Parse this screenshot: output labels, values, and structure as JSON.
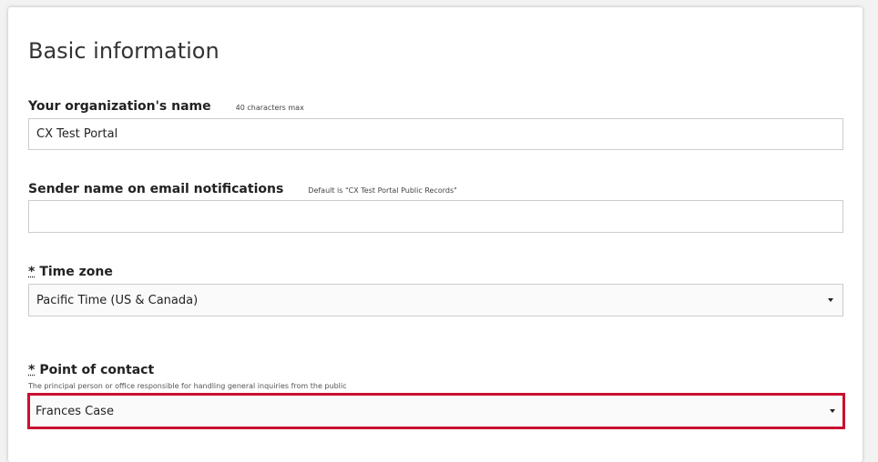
{
  "form": {
    "title": "Basic information",
    "org_name": {
      "label": "Your organization's name",
      "hint": "40 characters max",
      "value": "CX Test Portal"
    },
    "sender_name": {
      "label": "Sender name on email notifications",
      "hint": "Default is \"CX Test Portal Public Records\"",
      "value": ""
    },
    "time_zone": {
      "required_mark": "*",
      "label": "Time zone",
      "value": "Pacific Time (US & Canada)"
    },
    "point_of_contact": {
      "required_mark": "*",
      "label": "Point of contact",
      "description": "The principal person or office responsible for handling general inquiries from the public",
      "value": "Frances Case",
      "highlight_color": "#c8102e"
    }
  },
  "icons": {
    "dropdown": "caret-down-icon"
  }
}
